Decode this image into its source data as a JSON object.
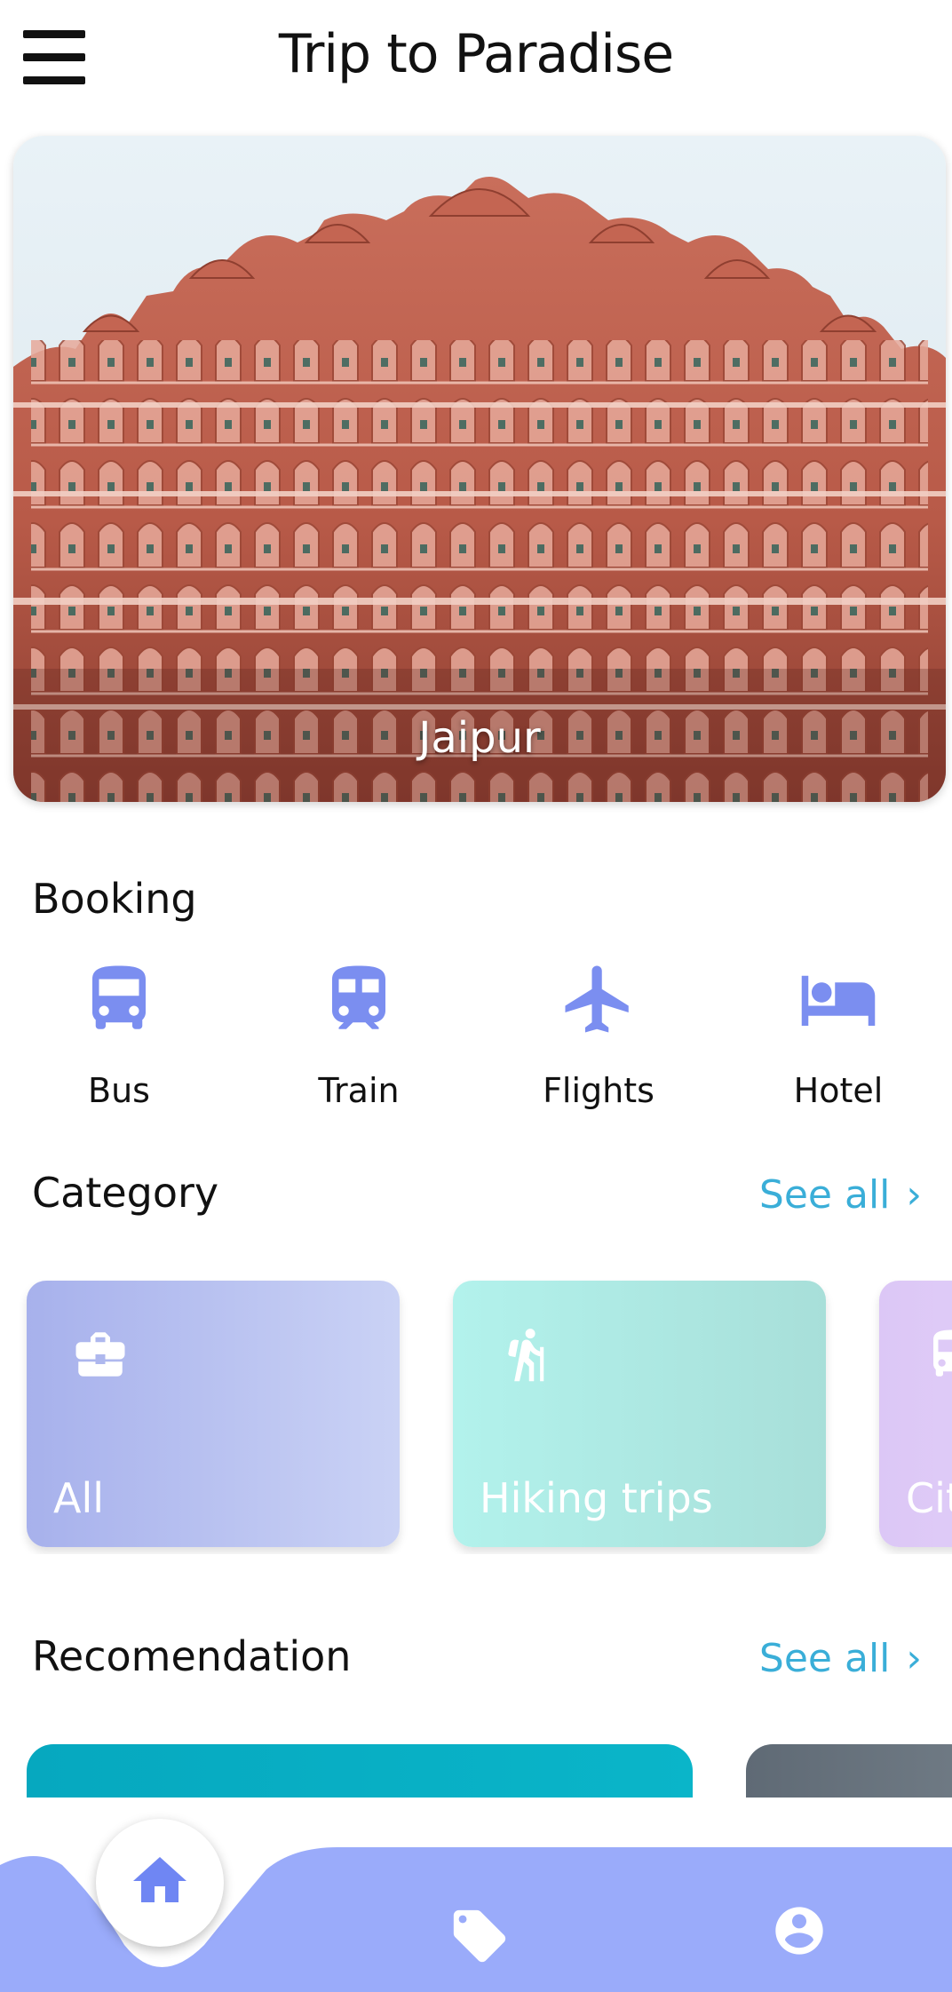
{
  "header": {
    "title": "Trip to Paradise",
    "menu_icon": "hamburger-menu-icon"
  },
  "hero": {
    "caption": "Jaipur"
  },
  "booking": {
    "title": "Booking",
    "accent_color": "#7b8ef0",
    "items": [
      {
        "label": "Bus",
        "icon": "bus-icon"
      },
      {
        "label": "Train",
        "icon": "train-icon"
      },
      {
        "label": "Flights",
        "icon": "airplane-icon"
      },
      {
        "label": "Hotel",
        "icon": "bed-icon"
      }
    ]
  },
  "category": {
    "title": "Category",
    "see_all": "See all",
    "cards": [
      {
        "label": "All",
        "icon": "briefcase-icon"
      },
      {
        "label": "Hiking trips",
        "icon": "hiker-icon"
      },
      {
        "label": "Cit",
        "icon": "bus-icon"
      }
    ]
  },
  "recommendation": {
    "title": "Recomendation",
    "see_all": "See all"
  },
  "nav": {
    "bar_color": "#9aabfa",
    "items": [
      {
        "icon": "home-icon",
        "active": true
      },
      {
        "icon": "tag-icon",
        "active": false
      },
      {
        "icon": "account-icon",
        "active": false
      }
    ]
  },
  "colors": {
    "link": "#3aaed8",
    "accent": "#7b8ef0"
  }
}
